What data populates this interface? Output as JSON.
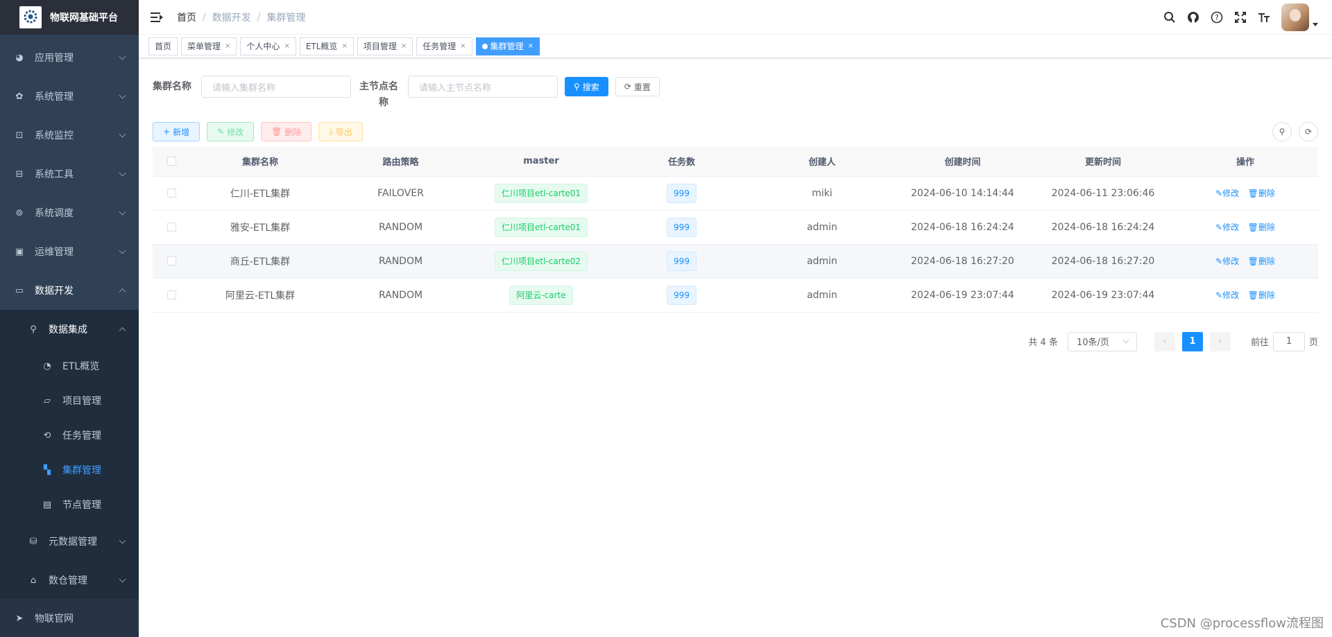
{
  "app": {
    "title": "物联网基础平台"
  },
  "sidebar": {
    "items": [
      {
        "label": "应用管理",
        "icon": "globe-icon"
      },
      {
        "label": "系统管理",
        "icon": "gear-icon"
      },
      {
        "label": "系统监控",
        "icon": "monitor-icon"
      },
      {
        "label": "系统工具",
        "icon": "toolbox-icon"
      },
      {
        "label": "系统调度",
        "icon": "schedule-icon"
      },
      {
        "label": "运维管理",
        "icon": "ops-icon"
      },
      {
        "label": "数据开发",
        "icon": "dev-icon"
      }
    ],
    "group": {
      "label": "数据集成",
      "icon": "tree-icon"
    },
    "leaves": [
      {
        "label": "ETL概览",
        "icon": "dashboard-icon"
      },
      {
        "label": "项目管理",
        "icon": "folder-icon"
      },
      {
        "label": "任务管理",
        "icon": "task-icon"
      },
      {
        "label": "集群管理",
        "icon": "cluster-icon"
      },
      {
        "label": "节点管理",
        "icon": "node-icon"
      }
    ],
    "after": [
      {
        "label": "元数据管理",
        "icon": "metadata-icon"
      },
      {
        "label": "数仓管理",
        "icon": "warehouse-icon"
      }
    ],
    "bottom": {
      "label": "物联官网",
      "icon": "send-icon"
    }
  },
  "breadcrumb": [
    "首页",
    "数据开发",
    "集群管理"
  ],
  "tags": [
    "首页",
    "菜单管理",
    "个人中心",
    "ETL概览",
    "项目管理",
    "任务管理",
    "集群管理"
  ],
  "search": {
    "cluster_label": "集群名称",
    "cluster_placeholder": "请输入集群名称",
    "master_label_1": "主节点名",
    "master_label_2": "称",
    "master_placeholder": "请输入主节点名称",
    "search_btn": "搜索",
    "reset_btn": "重置"
  },
  "toolbar": {
    "add": "新增",
    "edit": "修改",
    "delete": "删除",
    "export": "导出"
  },
  "table": {
    "headers": [
      "集群名称",
      "路由策略",
      "master",
      "任务数",
      "创建人",
      "创建时间",
      "更新时间",
      "操作"
    ],
    "rows": [
      {
        "name": "仁川-ETL集群",
        "strategy": "FAILOVER",
        "master": "仁川项目etl-carte01",
        "tasks": "999",
        "creator": "miki",
        "created": "2024-06-10 14:14:44",
        "updated": "2024-06-11 23:06:46"
      },
      {
        "name": "雅安-ETL集群",
        "strategy": "RANDOM",
        "master": "仁川项目etl-carte01",
        "tasks": "999",
        "creator": "admin",
        "created": "2024-06-18 16:24:24",
        "updated": "2024-06-18 16:24:24"
      },
      {
        "name": "商丘-ETL集群",
        "strategy": "RANDOM",
        "master": "仁川项目etl-carte02",
        "tasks": "999",
        "creator": "admin",
        "created": "2024-06-18 16:27:20",
        "updated": "2024-06-18 16:27:20"
      },
      {
        "name": "阿里云-ETL集群",
        "strategy": "RANDOM",
        "master": "阿里云-carte",
        "tasks": "999",
        "creator": "admin",
        "created": "2024-06-19 23:07:44",
        "updated": "2024-06-19 23:07:44"
      }
    ],
    "op_edit": "修改",
    "op_delete": "删除"
  },
  "pagination": {
    "total": "共 4 条",
    "size": "10条/页",
    "current": "1",
    "goto": "前往",
    "goto_value": "1",
    "page_suffix": "页"
  },
  "watermark": "CSDN @processflow流程图",
  "colors": {
    "sidebar": "#304156",
    "primary": "#1890ff",
    "active": "#409eff"
  }
}
